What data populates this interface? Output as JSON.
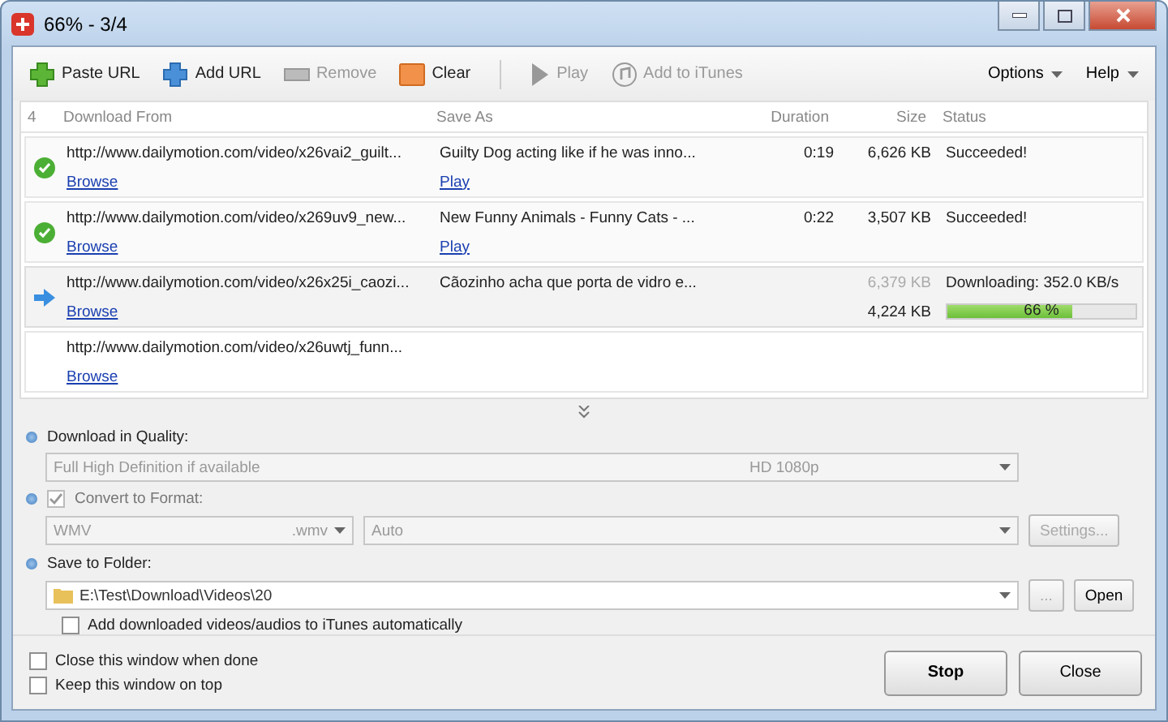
{
  "window": {
    "title": "66% - 3/4"
  },
  "toolbar": [
    {
      "kind": "paste",
      "label": "Paste URL",
      "disabled": false
    },
    {
      "kind": "add",
      "label": "Add URL",
      "disabled": false
    },
    {
      "kind": "remove",
      "label": "Remove",
      "disabled": true
    },
    {
      "kind": "clear",
      "label": "Clear",
      "disabled": false
    },
    {
      "kind": "play",
      "label": "Play",
      "disabled": true
    },
    {
      "kind": "itunes",
      "label": "Add to iTunes",
      "disabled": true
    }
  ],
  "menus": [
    "Options",
    "Help"
  ],
  "table": {
    "count": "4",
    "columns": [
      "Download From",
      "Save As",
      "Duration",
      "Size",
      "Status"
    ],
    "rows": [
      {
        "kind": "done",
        "url": "http://www.dailymotion.com/video/x26vai2_guilt...",
        "browse": "Browse",
        "save_as": "Guilty Dog acting like if he was inno...",
        "play": "Play",
        "duration": "0:19",
        "size": "6,626 KB",
        "status": "Succeeded!"
      },
      {
        "kind": "done",
        "url": "http://www.dailymotion.com/video/x269uv9_new...",
        "browse": "Browse",
        "save_as": "New Funny Animals - Funny Cats - ...",
        "play": "Play",
        "duration": "0:22",
        "size": "3,507 KB",
        "status": "Succeeded!"
      },
      {
        "kind": "downloading",
        "url": "http://www.dailymotion.com/video/x26x25i_caozi...",
        "browse": "Browse",
        "save_as": "Cãozinho acha que porta de vidro e...",
        "size_total": "6,379 KB",
        "size": "4,224 KB",
        "status": "Downloading: 352.0 KB/s",
        "level": 0.66,
        "percent": "66 %"
      },
      {
        "kind": "queued",
        "url": "http://www.dailymotion.com/video/x26uwtj_funn...",
        "browse": "Browse"
      }
    ]
  },
  "quality": {
    "label": "Download in Quality:",
    "value": "Full High Definition if available",
    "detail": "HD 1080p"
  },
  "convert": {
    "label": "Convert to Format:",
    "checked": true,
    "format": "WMV",
    "ext": ".wmv",
    "option": "Auto",
    "settings": "Settings..."
  },
  "folder": {
    "label": "Save to Folder:",
    "path": "E:\\Test\\Download\\Videos\\20",
    "browse": "...",
    "open": "Open"
  },
  "itunes_auto": {
    "label": "Add downloaded videos/audios to iTunes automatically",
    "checked": false
  },
  "footer": {
    "options": [
      {
        "label": "Close this window when done",
        "checked": false
      },
      {
        "label": "Keep this window on top",
        "checked": false
      }
    ],
    "stop": "Stop",
    "close": "Close"
  }
}
